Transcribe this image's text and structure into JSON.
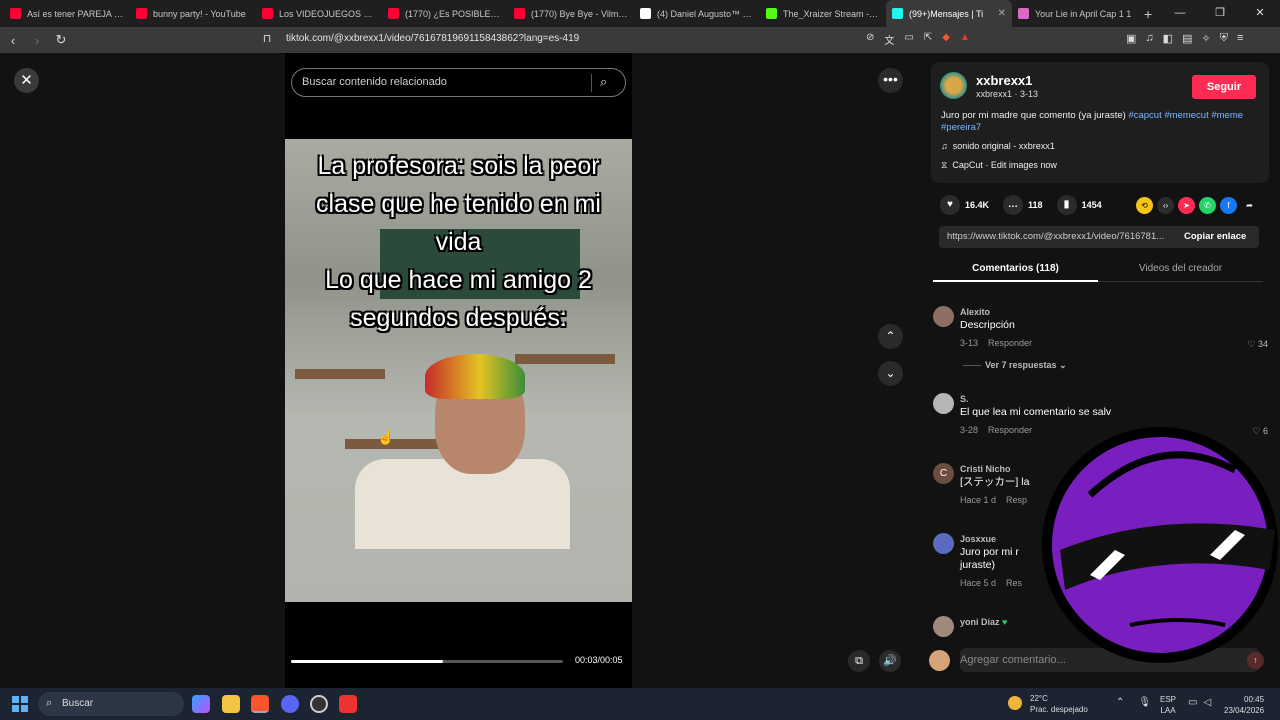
{
  "browser": {
    "tabs": [
      {
        "label": "Así es tener PAREJA en VE",
        "color": "#ff0033",
        "active": false
      },
      {
        "label": "bunny party! - YouTube",
        "color": "#ff0033",
        "active": false
      },
      {
        "label": "Los VIDEOJUEGOS FLASH",
        "color": "#ff0033",
        "active": false
      },
      {
        "label": "(1770) ¿Es POSIBLE amar e",
        "color": "#ff0033",
        "active": false
      },
      {
        "label": "(1770) Bye Bye - Vilma Pal",
        "color": "#ff0033",
        "active": false
      },
      {
        "label": "(4) Daniel Augusto™ on X:",
        "color": "#ffffff",
        "active": false
      },
      {
        "label": "The_Xraizer Stream - Watc",
        "color": "#53fc18",
        "active": false
      },
      {
        "label": "(99+)Mensajes | Ti",
        "color": "#25f4ee",
        "active": true
      },
      {
        "label": "Your Lie in April Cap 1 1",
        "color": "#d86cc4",
        "active": false
      }
    ],
    "new_tab_icon": "+",
    "url": "tiktok.com/@xxbrexx1/video/7616781969115843862?lang=es-419"
  },
  "video": {
    "search_placeholder": "Buscar contenido relacionado",
    "caption_lines": [
      "La profesora: sois la peor",
      "clase que he tenido en mi",
      "vida",
      "Lo que hace mi amigo 2",
      "segundos después:"
    ],
    "time": "00:03/00:05",
    "progress_fraction": 0.56
  },
  "creator": {
    "username": "xxbrexx1",
    "subline": "xxbrexx1 · 3-13",
    "follow_label": "Seguir",
    "description_text": "Juro por mi madre que comento (ya juraste) ",
    "hashtags": "#capcut #memecut #meme #pereira7",
    "sound": "sonido original - xxbrexx1",
    "capcut": "CapCut · Edit images now"
  },
  "stats": {
    "likes": "16.4K",
    "comments": "118",
    "saves": "1454"
  },
  "link": {
    "url": "https://www.tiktok.com/@xxbrexx1/video/7616781...",
    "copy_label": "Copiar enlace"
  },
  "panel_tabs": {
    "comments": "Comentarios (118)",
    "creator_videos": "Videos del creador"
  },
  "comments": [
    {
      "name": "Alexito",
      "text": "Descripción",
      "time": "3-13",
      "reply": "Responder",
      "likes": "♡ 34"
    },
    {
      "name": "S.",
      "text": "El que lea mi comentario se salv",
      "time": "3-28",
      "reply": "Responder",
      "likes": "♡ 6"
    },
    {
      "name": "Cristi Nicho",
      "text": "[ステッカー] la",
      "time": "Hace 1 d",
      "reply": "Resp",
      "likes": ""
    },
    {
      "name": "Josxxue",
      "text": "Juro por mi r\njuraste)",
      "time": "Hace 5 d",
      "reply": "Res",
      "likes": ""
    },
    {
      "name": "yoni Díaz",
      "text": "",
      "time": "",
      "reply": "",
      "likes": ""
    }
  ],
  "replies_toggle": "Ver 7 respuestas",
  "add_comment_placeholder": "Agregar comentario...",
  "taskbar": {
    "search_placeholder": "Buscar",
    "temperature": "22°C",
    "weather": "Prac. despejado",
    "lang_top": "ESP",
    "lang_bottom": "LAA",
    "time": "00:45",
    "date": "23/04/2026"
  },
  "colors": {
    "accent": "#fe2c55",
    "hashtag": "#7ab7ff",
    "overlay_purple": "#7a1fbf"
  }
}
